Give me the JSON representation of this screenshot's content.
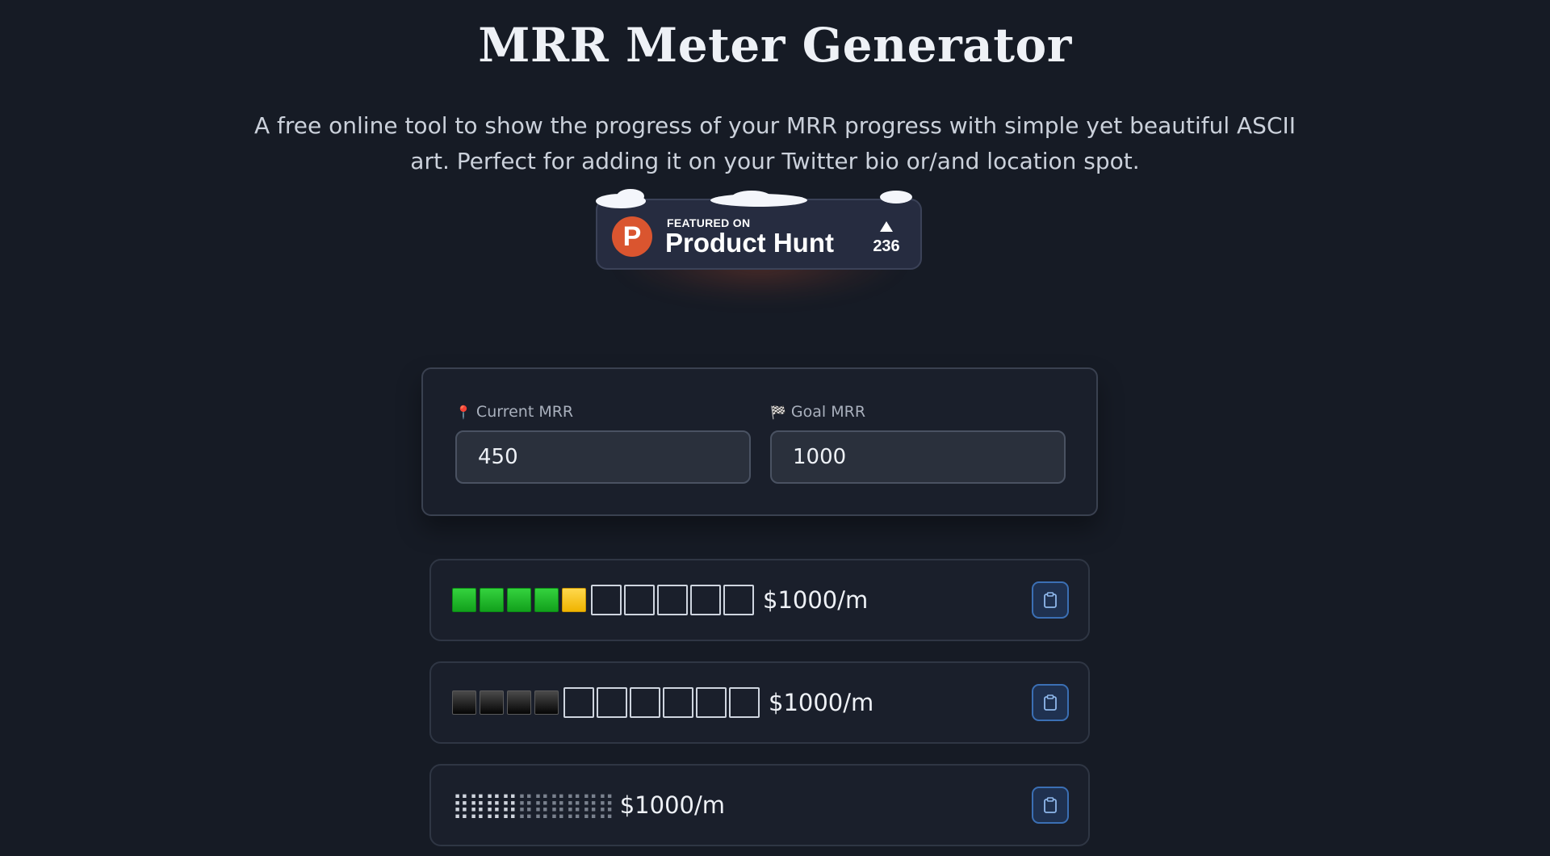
{
  "header": {
    "title": "MRR Meter Generator",
    "subtitle": "A free online tool to show the progress of your MRR progress with simple yet beautiful ASCII art. Perfect for adding it on your Twitter bio or/and location spot."
  },
  "product_hunt": {
    "logo_letter": "P",
    "featured": "FEATURED ON",
    "name": "Product Hunt",
    "count": "236",
    "colors": {
      "logo": "#da552f"
    }
  },
  "form": {
    "current": {
      "icon": "pushpin-icon",
      "label": "Current MRR",
      "value": "450"
    },
    "goal": {
      "icon": "checkered-flag-icon",
      "label": "Goal MRR",
      "value": "1000"
    }
  },
  "meters": [
    {
      "style": "green-yellow-squares",
      "progress": 0.45,
      "amount": "$1000/m",
      "copy_icon": "clipboard-icon"
    },
    {
      "style": "black-squares",
      "progress": 0.4,
      "amount": "$1000/m",
      "copy_icon": "clipboard-icon"
    },
    {
      "style": "braille-dots",
      "progress": 0.45,
      "amount": "$1000/m",
      "copy_icon": "clipboard-icon"
    }
  ],
  "colors": {
    "background": "#161b25",
    "card": "#1a1f2b",
    "accent": "#3b6fb4"
  }
}
